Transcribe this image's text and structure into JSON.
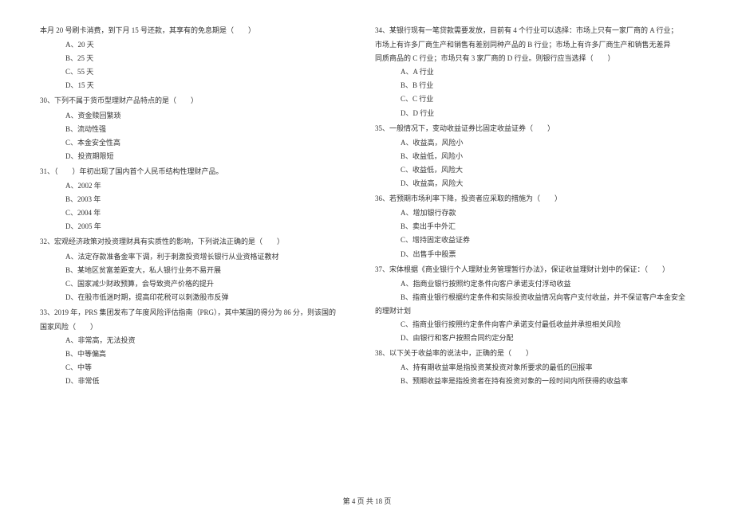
{
  "left_column": {
    "intro": "本月 20 号刷卡消费，到下月 15 号还款，其享有的免息期是（　　）",
    "intro_options": [
      "A、20 天",
      "B、25 天",
      "C、55 天",
      "D、15 天"
    ],
    "q30": {
      "text": "30、下列不属于货币型理财产品特点的是（　　）",
      "options": [
        "A、资金赎回繁琐",
        "B、流动性强",
        "C、本金安全性高",
        "D、投资期限短"
      ]
    },
    "q31": {
      "text": "31、（　　）年初出现了国内首个人民币结构性理财产品。",
      "options": [
        "A、2002 年",
        "B、2003 年",
        "C、2004 年",
        "D、2005 年"
      ]
    },
    "q32": {
      "text": "32、宏观经济政策对投资理财具有实质性的影响，下列说法正确的是（　　）",
      "options": [
        "A、法定存款准备金率下调，利于刺激投资增长银行从业资格证教材",
        "B、某地区贫富差距变大，私人银行业务不易开展",
        "C、国家减少财政预算，会导致资产价格的提升",
        "D、在股市低迷时期，提高印花税可以刺激股市反弹"
      ]
    },
    "q33": {
      "text": "33、2019 年，PRS 集团发布了年度风险评估指南（PRG），其中某国的得分为 86 分，则该国的",
      "text2": "国家风险（　　）",
      "options": [
        "A、非常高，无法投资",
        "B、中等偏高",
        "C、中等",
        "D、非常低"
      ]
    }
  },
  "right_column": {
    "q34": {
      "text": "34、某银行现有一笔贷款需要发放，目前有 4 个行业可以选择：市场上只有一家厂商的 A 行业；",
      "text2": "市场上有许多厂商生产和销售有差别同种产品的 B 行业；市场上有许多厂商生产和销售无差异",
      "text3": "同质商品的 C 行业；市场只有 3 家厂商的 D 行业。则银行应当选择（　　）",
      "options": [
        "A、A 行业",
        "B、B 行业",
        "C、C 行业",
        "D、D 行业"
      ]
    },
    "q35": {
      "text": "35、一般情况下，变动收益证券比固定收益证券（　　）",
      "options": [
        "A、收益高，风险小",
        "B、收益低，风险小",
        "C、收益低，风险大",
        "D、收益高，风险大"
      ]
    },
    "q36": {
      "text": "36、若预期市场利率下降，投资者应采取的措施为（　　）",
      "options": [
        "A、增加银行存款",
        "B、卖出手中外汇",
        "C、增持固定收益证券",
        "D、出售手中股票"
      ]
    },
    "q37": {
      "text": "37、宋体根据《商业银行个人理财业务管理暂行办法》，保证收益理财计划中的保证：（　　）",
      "options": [
        "A、指商业银行按照约定条件向客户承诺支付浮动收益",
        "B、指商业银行根据约定条件和实际投资收益情况向客户支付收益，并不保证客户本金安全"
      ],
      "text2": "的理财计划",
      "options2": [
        "C、指商业银行按照约定条件向客户承诺支付最低收益并承担相关风险",
        "D、由银行和客户按照合同约定分配"
      ]
    },
    "q38": {
      "text": "38、以下关于收益率的说法中，正确的是（　　）",
      "options": [
        "A、持有期收益率是指投资某投资对象所要求的最低的回报率",
        "B、预期收益率是指投资者在持有投资对象的一段时间内所获得的收益率"
      ]
    }
  },
  "footer": "第 4 页 共 18 页"
}
